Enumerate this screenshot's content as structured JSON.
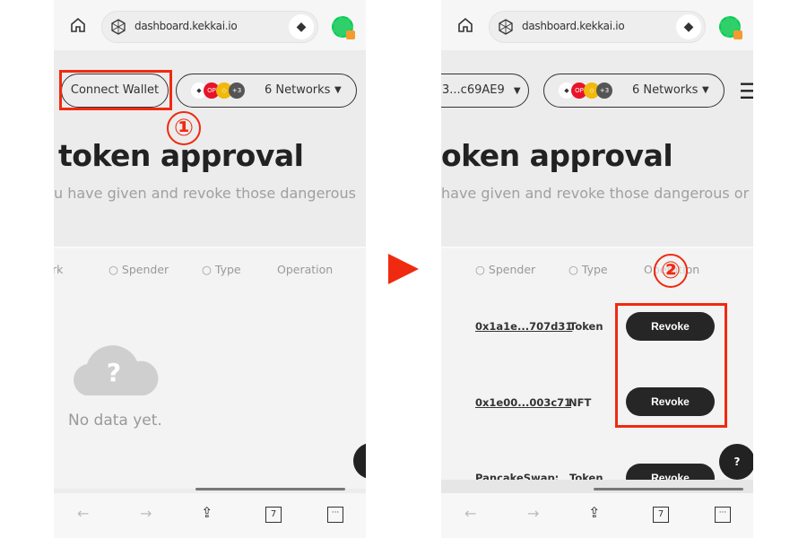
{
  "browser": {
    "url": "dashboard.kekkai.io",
    "tab_count": "7"
  },
  "left": {
    "connect_wallet": "Connect Wallet",
    "networks": "6 Networks",
    "chain_more": "+3",
    "title": "token approval",
    "subtitle": "u have given and revoke those dangerous",
    "headers": {
      "network": "rk",
      "spender": "Spender",
      "type": "Type",
      "operation": "Operation"
    },
    "empty": "No data yet.",
    "step": "①"
  },
  "right": {
    "wallet": "3...c69AE9",
    "networks": "6 Networks",
    "chain_more": "+3",
    "title": "oken approval",
    "subtitle": "have given and revoke those dangerous or r",
    "headers": {
      "spender": "Spender",
      "type": "Type",
      "operation": "Operation"
    },
    "rows": [
      {
        "spender": "0x1a1e...707d31",
        "type": "Token",
        "action": "Revoke"
      },
      {
        "spender": "0x1e00...003c71",
        "type": "NFT",
        "action": "Revoke"
      },
      {
        "spender": "PancakeSwap:",
        "type": "Token",
        "action": "Revoke"
      }
    ],
    "step": "②",
    "help": "?"
  },
  "colors": {
    "annotation": "#f02a10",
    "button": "#262626",
    "arrow": "#f02a10"
  }
}
